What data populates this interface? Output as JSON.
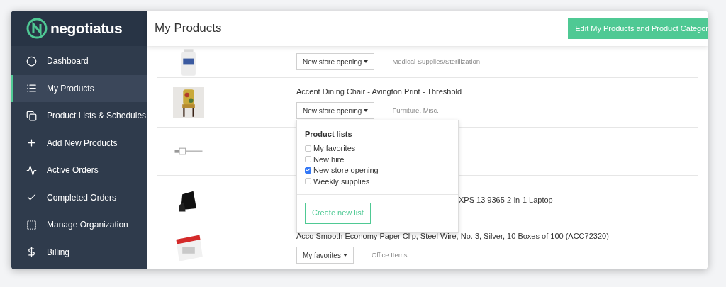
{
  "sidebar": {
    "logo": "negotiatus",
    "items": [
      {
        "label": "Dashboard",
        "selected": false
      },
      {
        "label": "My Products",
        "selected": true
      },
      {
        "label": "Product Lists & Schedules",
        "selected": false
      },
      {
        "label": "Add New Products",
        "selected": false
      },
      {
        "label": "Active Orders",
        "selected": false
      },
      {
        "label": "Completed Orders",
        "selected": false
      },
      {
        "label": "Manage Organization",
        "selected": false
      },
      {
        "label": "Billing",
        "selected": false
      }
    ]
  },
  "header": {
    "title": "My Products",
    "button": "Edit My Products and Product Categor"
  },
  "products": [
    {
      "kind": "visible",
      "list": "New store opening",
      "category": "Medical Supplies/Sterilization"
    },
    {
      "kind": "visible",
      "title": "Accent Dining Chair - Avington Print - Threshold",
      "list": "New store opening",
      "category": "Furniture, Misc."
    },
    {
      "kind": "covered"
    },
    {
      "kind": "covered",
      "title": "XPS 13 9365 2-in-1 Laptop"
    },
    {
      "kind": "visible",
      "title": "Acco Smooth Economy Paper Clip, Steel Wire, No. 3, Silver, 10 Boxes of 100 (ACC72320)",
      "list": "My favorites",
      "category": "Office Items"
    }
  ],
  "popover": {
    "title": "Product lists",
    "options": [
      {
        "label": "My favorites",
        "checked": false
      },
      {
        "label": "New hire",
        "checked": false
      },
      {
        "label": "New store opening",
        "checked": true
      },
      {
        "label": "Weekly supplies",
        "checked": false
      }
    ],
    "button": "Create new list"
  }
}
